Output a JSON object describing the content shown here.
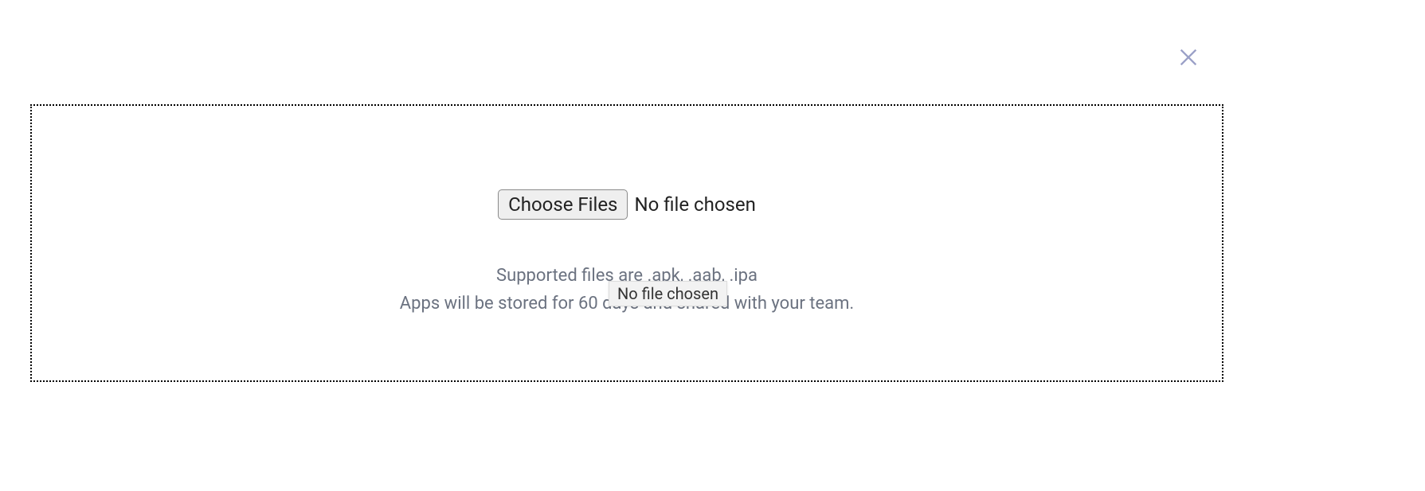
{
  "close_icon": "close",
  "upload": {
    "choose_button_label": "Choose Files",
    "file_status": "No file chosen",
    "tooltip": "No file chosen",
    "supported_text": "Supported files are .apk, .aab, .ipa",
    "storage_text": "Apps will be stored for 60 days and shared with your team."
  }
}
